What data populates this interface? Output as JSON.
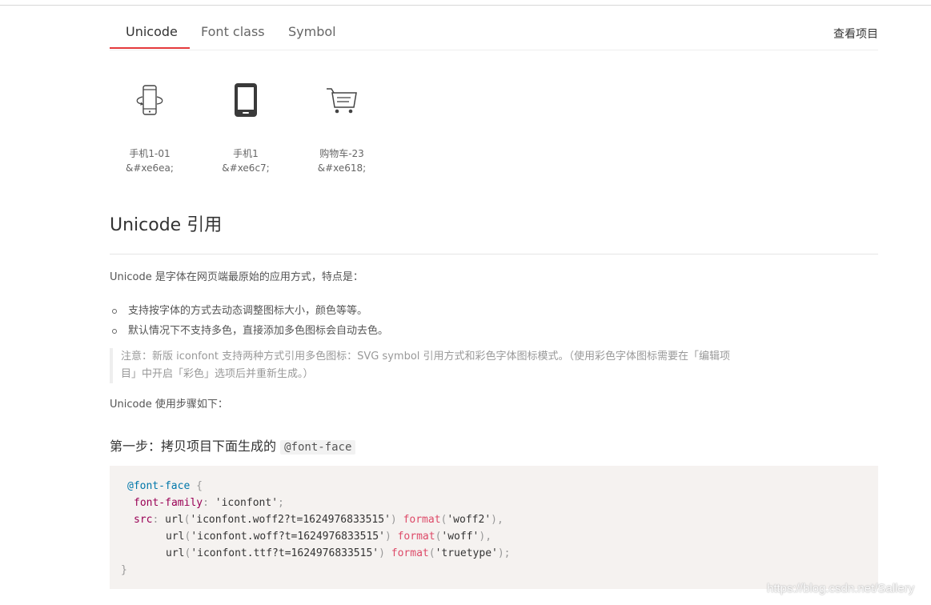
{
  "tabs": [
    {
      "label": "Unicode",
      "active": true
    },
    {
      "label": "Font class",
      "active": false
    },
    {
      "label": "Symbol",
      "active": false
    }
  ],
  "view_project_label": "查看项目",
  "accent_color": "#e4393c",
  "icons": [
    {
      "icon": "phone-rotate-icon",
      "name": "手机1-01",
      "code": "&#xe6ea;"
    },
    {
      "icon": "mobile-phone-icon",
      "name": "手机1",
      "code": "&#xe6c7;"
    },
    {
      "icon": "shopping-cart-icon",
      "name": "购物车-23",
      "code": "&#xe618;"
    }
  ],
  "section": {
    "title": "Unicode 引用",
    "intro": "Unicode 是字体在网页端最原始的应用方式，特点是：",
    "features": [
      "支持按字体的方式去动态调整图标大小，颜色等等。",
      "默认情况下不支持多色，直接添加多色图标会自动去色。"
    ],
    "note": "注意：新版 iconfont 支持两种方式引用多色图标：SVG symbol 引用方式和彩色字体图标模式。（使用彩色字体图标需要在「编辑项目」中开启「彩色」选项后并重新生成。）",
    "steps_intro": "Unicode 使用步骤如下：",
    "step1_title": "第一步：拷贝项目下面生成的",
    "step1_code": "@font-face"
  },
  "code": {
    "at_rule": "@font-face",
    "open_brace": "{",
    "family_prop": "font-family",
    "family_value": "'iconfont'",
    "src_prop": "src",
    "url_fn": "url",
    "woff2_url": "'iconfont.woff2?t=1624976833515'",
    "woff_url": "'iconfont.woff?t=1624976833515'",
    "ttf_url": "'iconfont.ttf?t=1624976833515'",
    "format_fn": "format",
    "woff2_fmt": "'woff2'",
    "woff_fmt": "'woff'",
    "ttf_fmt": "'truetype'",
    "close_brace": "}"
  },
  "watermark": "https://blog.csdn.net/Sallery"
}
